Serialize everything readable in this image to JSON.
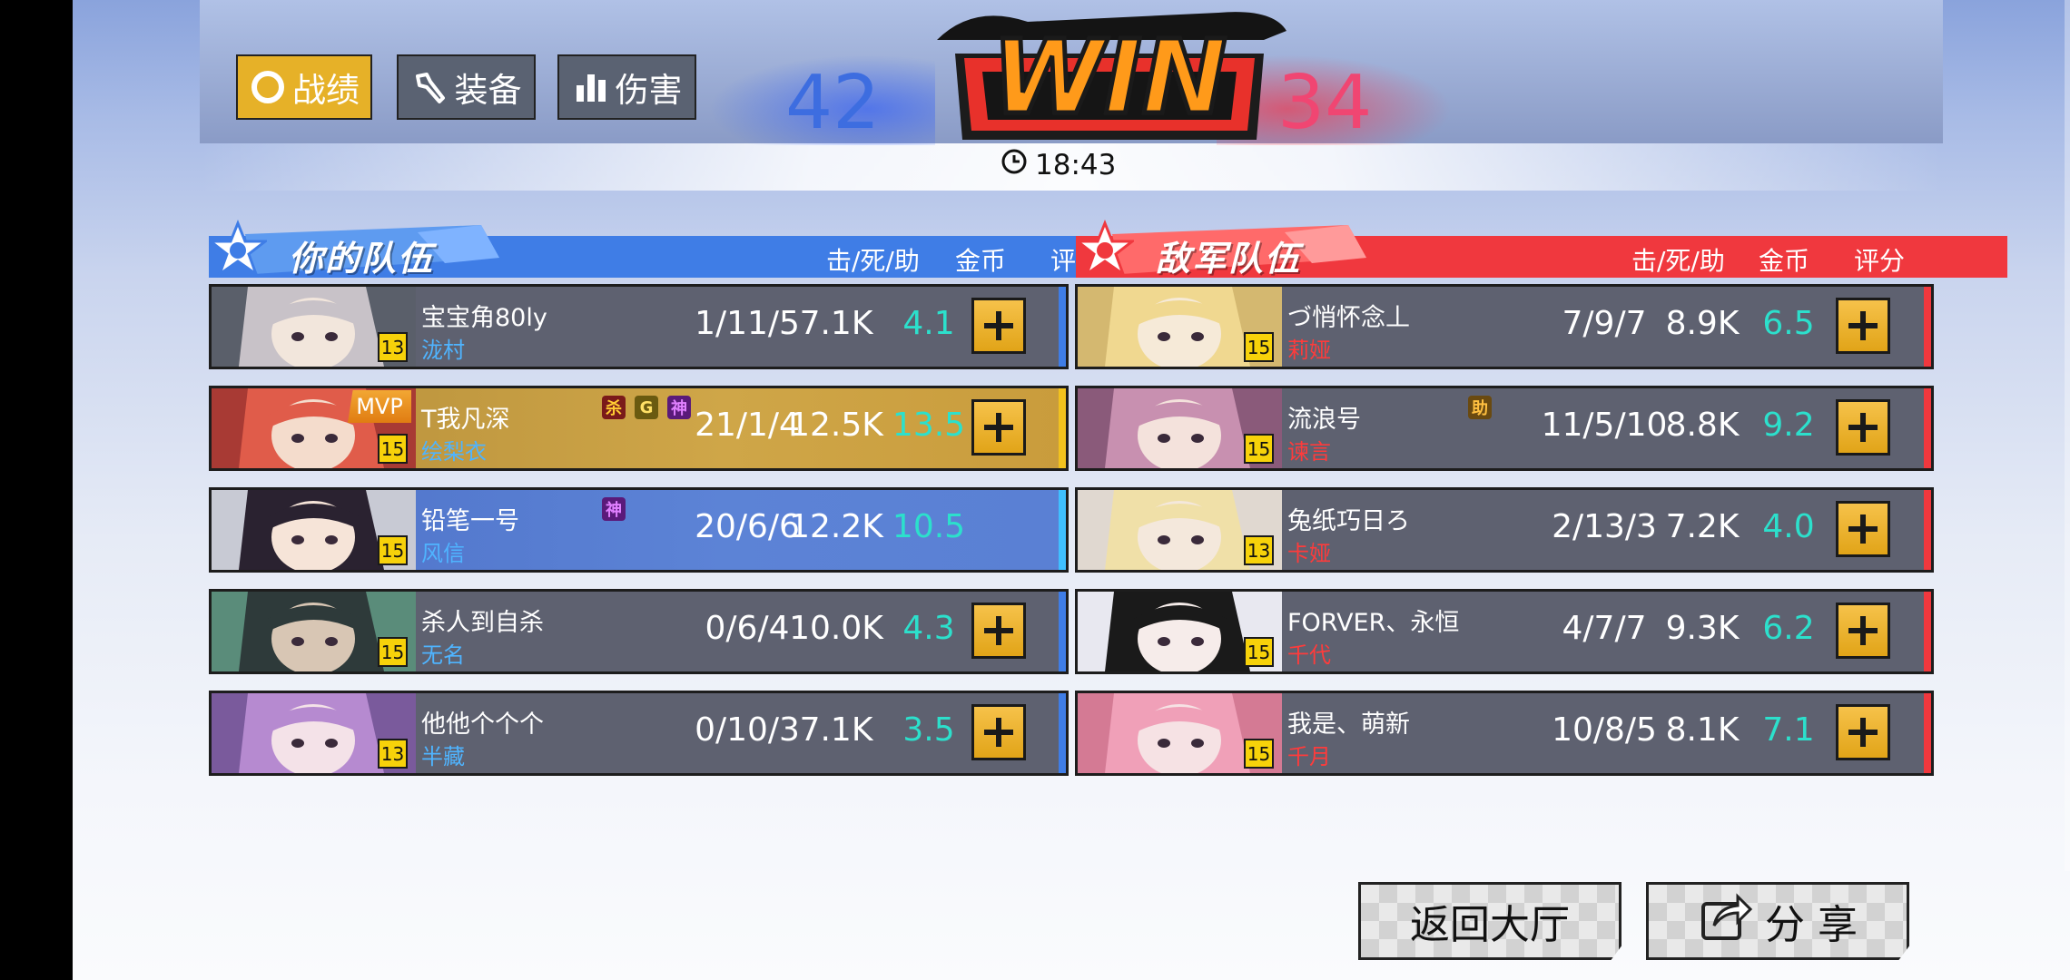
{
  "tabs": [
    {
      "label": "战绩",
      "icon": "ring-icon",
      "active": true
    },
    {
      "label": "装备",
      "icon": "wrench-icon",
      "active": false
    },
    {
      "label": "伤害",
      "icon": "bar-chart-icon",
      "active": false
    }
  ],
  "score": {
    "left": "42",
    "right": "34",
    "result": "WIN"
  },
  "time": "18:43",
  "columns": {
    "kda": "击/死/助",
    "gold": "金币",
    "rating": "评分"
  },
  "teams": {
    "ally": {
      "title": "你的队伍",
      "color": "#3f7de6",
      "players": [
        {
          "name": "宝宝角80ly",
          "hero": "泷村",
          "level": "13",
          "kda": "1/11/5",
          "gold": "7.1K",
          "rating": "4.1",
          "plus": true,
          "mvp": false,
          "badges": []
        },
        {
          "name": "T我凡深",
          "hero": "绘梨衣",
          "level": "15",
          "kda": "21/1/4",
          "gold": "12.5K",
          "rating": "13.5",
          "plus": true,
          "mvp": true,
          "mvp_label": "MVP",
          "badges": [
            "杀",
            "G",
            "神"
          ]
        },
        {
          "name": "铅笔一号",
          "hero": "风信",
          "level": "15",
          "kda": "20/6/6",
          "gold": "12.2K",
          "rating": "10.5",
          "plus": false,
          "mvp": false,
          "self": true,
          "badges": [
            "神"
          ]
        },
        {
          "name": "杀人到自杀",
          "hero": "无名",
          "level": "15",
          "kda": "0/6/4",
          "gold": "10.0K",
          "rating": "4.3",
          "plus": true,
          "mvp": false,
          "badges": []
        },
        {
          "name": "他他个个个",
          "hero": "半藏",
          "level": "13",
          "kda": "0/10/3",
          "gold": "7.1K",
          "rating": "3.5",
          "plus": true,
          "mvp": false,
          "badges": []
        }
      ]
    },
    "enemy": {
      "title": "敌军队伍",
      "color": "#f0383e",
      "players": [
        {
          "name": "づ悄怀念丄",
          "hero": "莉娅",
          "level": "15",
          "kda": "7/9/7",
          "gold": "8.9K",
          "rating": "6.5",
          "plus": true,
          "badges": []
        },
        {
          "name": "流浪号",
          "hero": "谏言",
          "level": "15",
          "kda": "11/5/10",
          "gold": "8.8K",
          "rating": "9.2",
          "plus": true,
          "badges": [
            "助"
          ]
        },
        {
          "name": "兔纸巧日ろ",
          "hero": "卡娅",
          "level": "13",
          "kda": "2/13/3",
          "gold": "7.2K",
          "rating": "4.0",
          "plus": true,
          "badges": []
        },
        {
          "name": "FORVER、永恒",
          "hero": "千代",
          "level": "15",
          "kda": "4/7/7",
          "gold": "9.3K",
          "rating": "6.2",
          "plus": true,
          "badges": []
        },
        {
          "name": "我是、萌新",
          "hero": "千月",
          "level": "15",
          "kda": "10/8/5",
          "gold": "8.1K",
          "rating": "7.1",
          "plus": true,
          "badges": []
        }
      ]
    }
  },
  "buttons": {
    "back": "返回大厅",
    "share": "分 享"
  },
  "colors": {
    "gold_button": "#e6b128",
    "rating": "#2ce0cc",
    "ally_hero": "#4fb4ff",
    "enemy_hero": "#ff3b3b",
    "mvp_row": "#c9a040",
    "self_row": "#5c83d6"
  }
}
